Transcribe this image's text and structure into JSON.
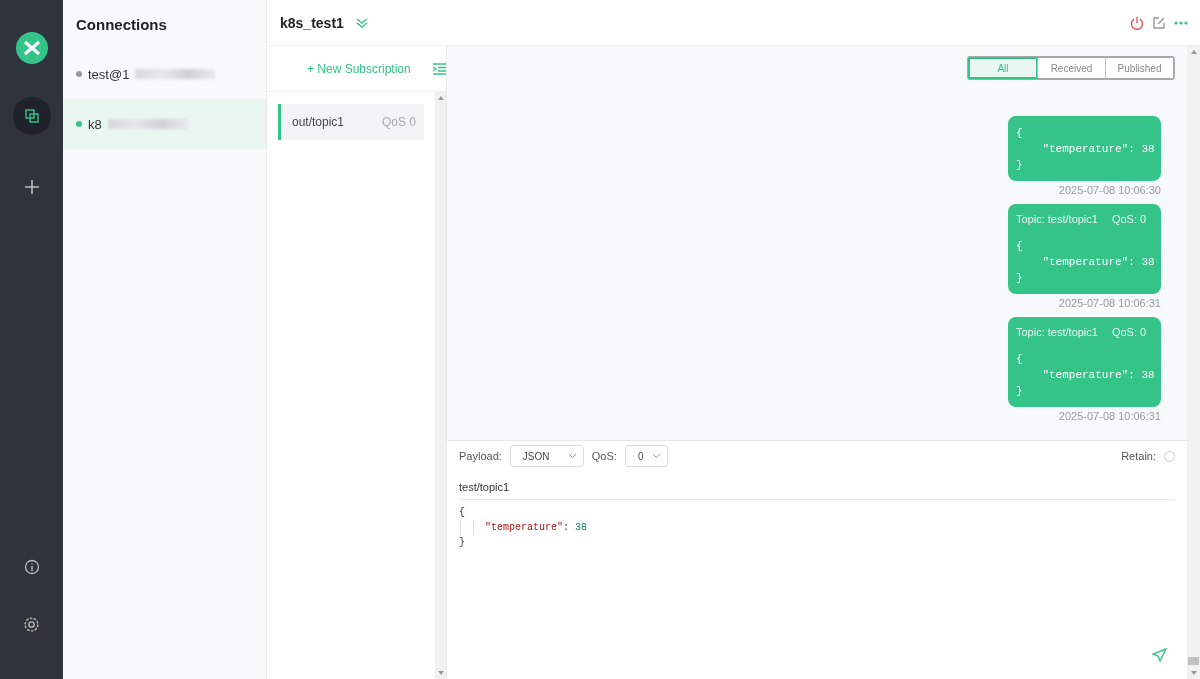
{
  "connections": {
    "title": "Connections",
    "items": [
      {
        "name": "test@1",
        "online": false,
        "selected": false
      },
      {
        "name": "k8",
        "online": true,
        "selected": true
      }
    ]
  },
  "header": {
    "title": "k8s_test1"
  },
  "subscriptions": {
    "new_label": "+ New Subscription",
    "items": [
      {
        "topic": "out/topic1",
        "qos": "QoS 0",
        "color": "#34c388"
      }
    ]
  },
  "filters": [
    {
      "label": "All",
      "selected": true
    },
    {
      "label": "Received",
      "selected": false
    },
    {
      "label": "Published",
      "selected": false
    }
  ],
  "messages": [
    {
      "body": [
        "{",
        "    \"temperature\": 38",
        "}"
      ],
      "time": "2025-07-08 10:06:30"
    },
    {
      "topic": "Topic: test/topic1",
      "qos": "QoS: 0",
      "body": [
        "{",
        "    \"temperature\": 38",
        "}"
      ],
      "time": "2025-07-08 10:06:31"
    },
    {
      "topic": "Topic: test/topic1",
      "qos": "QoS: 0",
      "body": [
        "{",
        "    \"temperature\": 38",
        "}"
      ],
      "time": "2025-07-08 10:06:31"
    }
  ],
  "composer": {
    "payload_label": "Payload:",
    "payload_format": "JSON",
    "qos_label": "QoS:",
    "qos": "0",
    "retain_label": "Retain:",
    "retain": false,
    "topic": "test/topic1",
    "payload": [
      {
        "text": "{",
        "indent": false
      },
      {
        "key": "\"temperature\"",
        "sep": ": ",
        "value": "38",
        "indent": true
      },
      {
        "text": "}",
        "indent": false
      }
    ]
  }
}
